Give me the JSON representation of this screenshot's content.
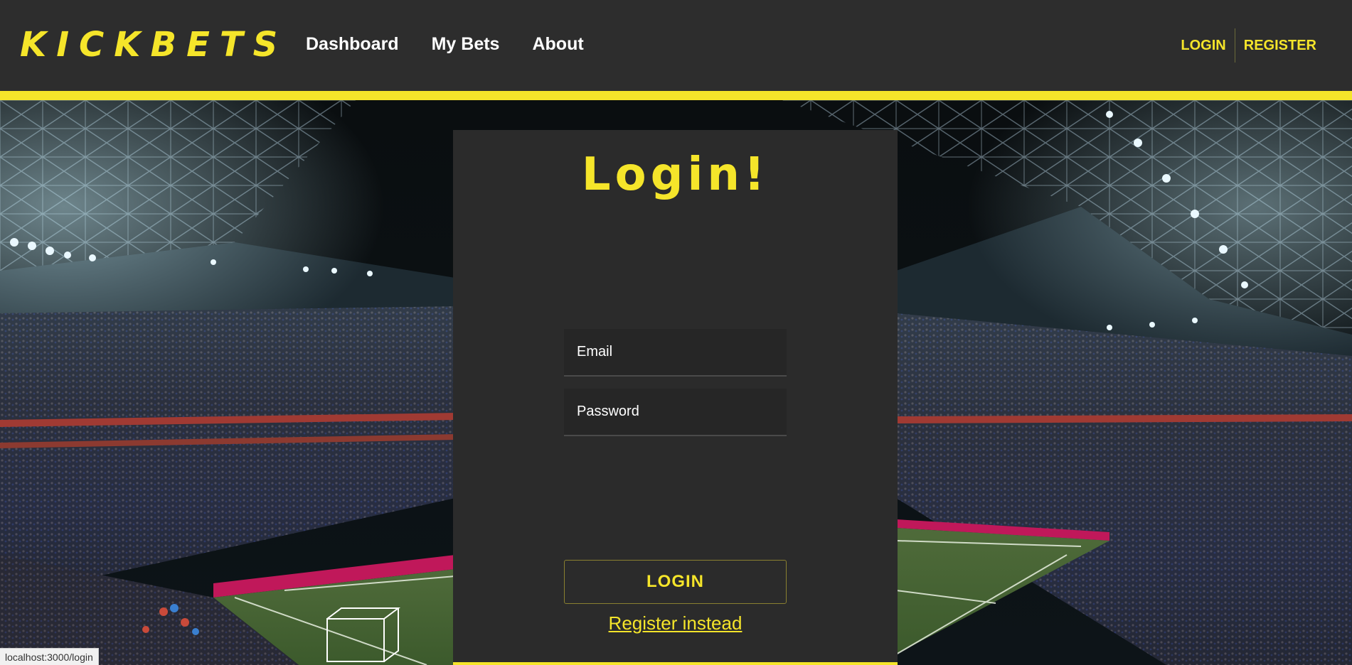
{
  "brand": {
    "logo": "KICKBETS"
  },
  "nav": {
    "items": [
      {
        "label": "Dashboard"
      },
      {
        "label": "My Bets"
      },
      {
        "label": "About"
      }
    ]
  },
  "auth": {
    "login_label": "LOGIN",
    "register_label": "REGISTER"
  },
  "login_card": {
    "title": "Login!",
    "email_placeholder": "Email",
    "password_placeholder": "Password",
    "submit_label": "LOGIN",
    "register_link": "Register instead"
  },
  "status_bar": {
    "url": "localhost:3000/login"
  },
  "colors": {
    "accent": "#f5e52a",
    "header_bg": "#2d2d2d",
    "card_bg": "#2b2b2b",
    "field_bg": "#262626"
  },
  "background": {
    "description_icon": "stadium-photo"
  }
}
